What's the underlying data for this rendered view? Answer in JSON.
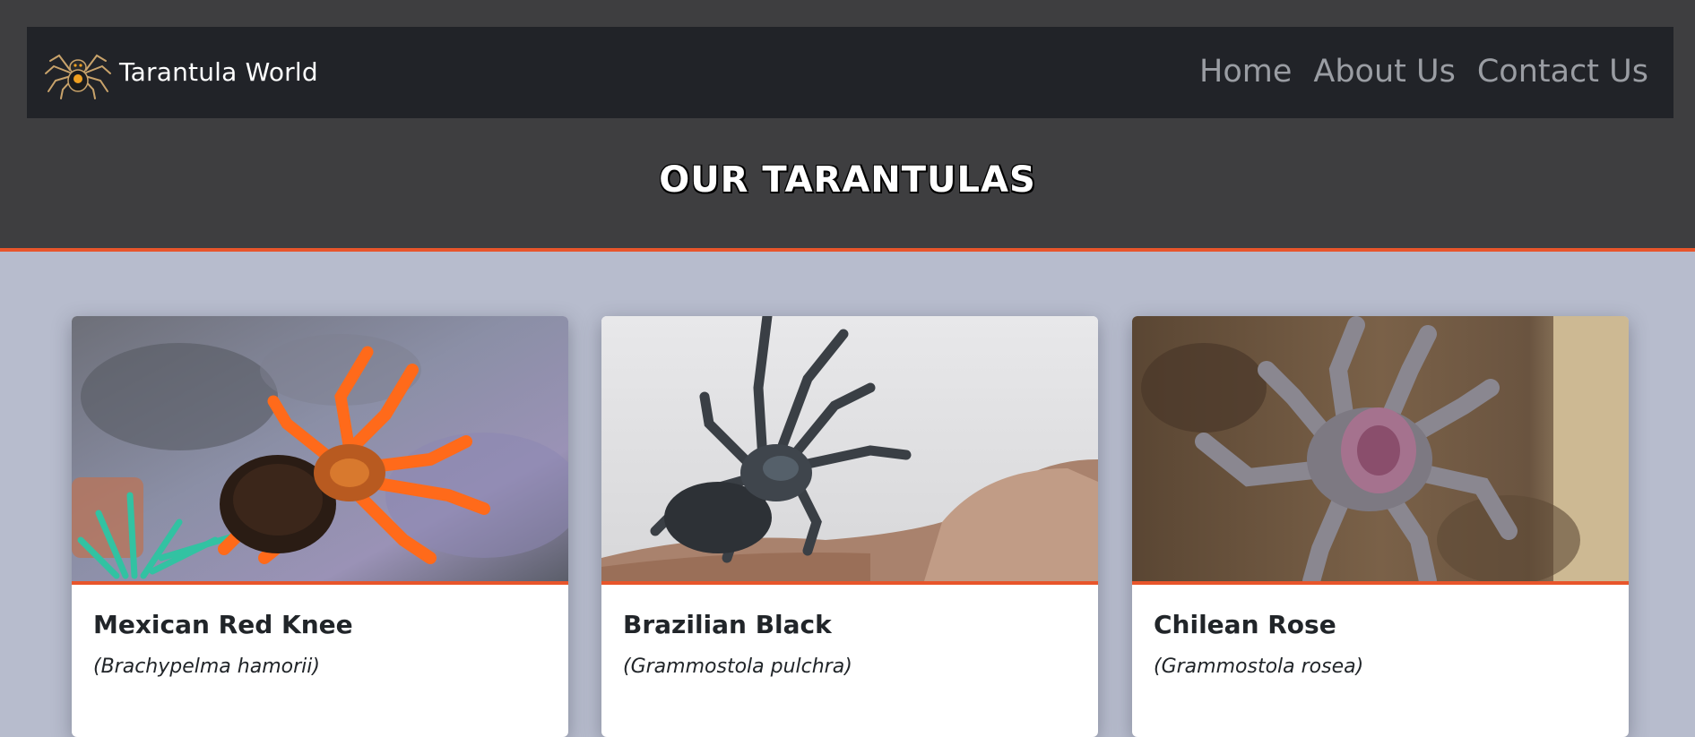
{
  "navbar": {
    "brand_name": "Tarantula World",
    "logo_icon": "tarantula-logo-icon",
    "links": [
      {
        "label": "Home"
      },
      {
        "label": "About Us"
      },
      {
        "label": "Contact Us"
      }
    ]
  },
  "page": {
    "title": "OUR TARANTULAS"
  },
  "colors": {
    "header_bg": "#3e3e40",
    "navbar_bg": "#212328",
    "accent": "#e8552b",
    "page_bg": "#b7bccd",
    "nav_link": "#9a9da3"
  },
  "cards": [
    {
      "name": "Mexican Red Knee",
      "scientific": "(Brachypelma hamorii)",
      "photo": "mexican-red-knee-photo"
    },
    {
      "name": "Brazilian Black",
      "scientific": "(Grammostola pulchra)",
      "photo": "brazilian-black-photo"
    },
    {
      "name": "Chilean Rose",
      "scientific": "(Grammostola rosea)",
      "photo": "chilean-rose-photo"
    }
  ]
}
